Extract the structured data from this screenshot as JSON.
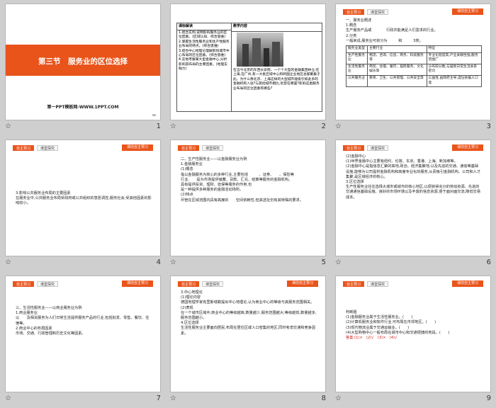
{
  "footer_star": "☆",
  "colors": {
    "accent": "#e9541b",
    "highlight": "#d01818"
  },
  "tabs": {
    "first": "自主预习",
    "second": "课堂探究"
  },
  "tag": "课前自主预习",
  "slides": [
    {
      "number": "1",
      "title": "第三节　服务业的区位选择",
      "subtitle": "第一PPT模板网-WWW.1PPT.COM"
    },
    {
      "number": "2",
      "table": {
        "left_header": "课标解读",
        "right_header": "教学内容",
        "left_items": [
          "1.结合实例,说明影响服务业的区位因素。(区域认知、综合思维)",
          "2.掌握生活性服务业和生产性服务业布局的特点。(综合思维)",
          "3.结合中心地理论理解影响城市中心布局的区位因素。(综合思维)",
          "4.实地考察某大型金融中心,分析影响其布局的主要因素。(地理实践力)"
        ],
        "right_text": "在当今北京的东西长安街、一个个大型的金融集团林立;在上海,在广州,有一大批区域中心和跨国企业地区总部聚集于此。为什么像北京、上海这样的大型城市能吸引如此多的金融机构入驻?与其他城市相比,优势在哪里?影响这类服务业布局的区位因素有哪些?"
      }
    },
    {
      "number": "3",
      "lines": [
        "一、服务业概述",
        "1.概念",
        "生产服务产品或",
        "行政并能满足人们需求的行业。",
        "2.分类",
        "一般来说,服务业可划分为",
        "和",
        "3类。"
      ],
      "table": {
        "headers": [
          "服务业类型",
          "主要行业",
          "特征"
        ],
        "rows": [
          [
            "生产性服务业",
            "物流、咨询、信息、商务、科技服务等",
            "专业化程度高,产业关联性强,服务范围广"
          ],
          [
            "生活性服务业",
            "商贸、住宿、餐饮、居民服务、文化娱乐等",
            "分布较分散,与居民日常生活关系密切"
          ],
          [
            "公共服务业",
            "教育、卫生、公共管理、公共安全等",
            "公益性,由政府主导,选址依据人口等"
          ]
        ]
      }
    },
    {
      "number": "4",
      "lines": [
        "3.影响公共服务业布局的主要因素",
        "在服务业中,公共服务业布局受政府或公共组织的意愿调控,服务社会,受其他因素的影响较小。"
      ]
    },
    {
      "number": "5",
      "lines": [
        "二、生产性服务业——以金融服务业为例",
        "1.金融服务业",
        "(1)概念",
        "指以金融服务为核心的多种行业,主要包括",
        "、证券、",
        "、保险等",
        "行业,",
        "是为市场提供储蓄、贷款、汇兑、结算等服务的金融机构。",
        "具有提供投资、理财、担保等服务的作用,也",
        "是一种提供多种服务的金融活动场所。",
        "(2)特点",
        "尽管在区域范围内具有高度的",
        "空间依赖性,",
        "但其选址仍有其特殊的要求。"
      ]
    },
    {
      "number": "6",
      "lines": [
        "(2)金融中心",
        "(1)世界金融中心主要有纽约、伦敦、东京、香港、上海、新加坡等。",
        "(2)金融中心是指信息汇聚的高地,政治、经济集聚地,以及先进的交通、通信等基础设施,能够为公司提供金融机构和高度专业化的服务,从而吸引金融机构、公司和人才集聚,是区域经济的核心。",
        "3.区位选择",
        "生产性服务业往往选择大城市或城市的核心地区,以便获得充分的劳动资源、先进的交通通信基础设施、良好的市场环境以及丰富的信息资源,便于面对面交流,降低交易成本。"
      ]
    },
    {
      "number": "7",
      "lines": [
        "三、生活性服务业——以商业服务业为例",
        "1.商业服务业",
        "以　　及相关服务为人们日常生活提供服务产品的行业,包括批发、零售、餐饮、住宿等。",
        "2.商业中心的布局因素",
        "市场、交通、行政管理和历史文化等因素。"
      ]
    },
    {
      "number": "8",
      "lines": [
        "3.中心地理论",
        "(1)理论内容",
        "德国地理学家克里斯塔勒提出中心地理论,认为商业中心的等级与其服务范围相关。",
        "(2)表现",
        "在一个城市区域中,商业中心的等级越高,数量越少,服务范围越大;等级越低,数量越多,服务范围越小。",
        "4.区位选择",
        "生活性服务业主要面向居民,布局在居住区或人口密集的地区,同时考虑交通和竞争因素。"
      ]
    },
    {
      "number": "9",
      "lines": [
        "判断题",
        "(1)金融服务业属于生活性服务业。(　　)",
        "(2)计算机服务业和软件行业,可布局在市郊地区。(　　)",
        "(3)现代物流业属于交通运输业。(　　)",
        "(4)大型购物中心一般布局在城市中心和交通便捷的地段。(　　)"
      ],
      "answer": "答案:(1)×　(2)√　(3)×　(4)√"
    }
  ]
}
